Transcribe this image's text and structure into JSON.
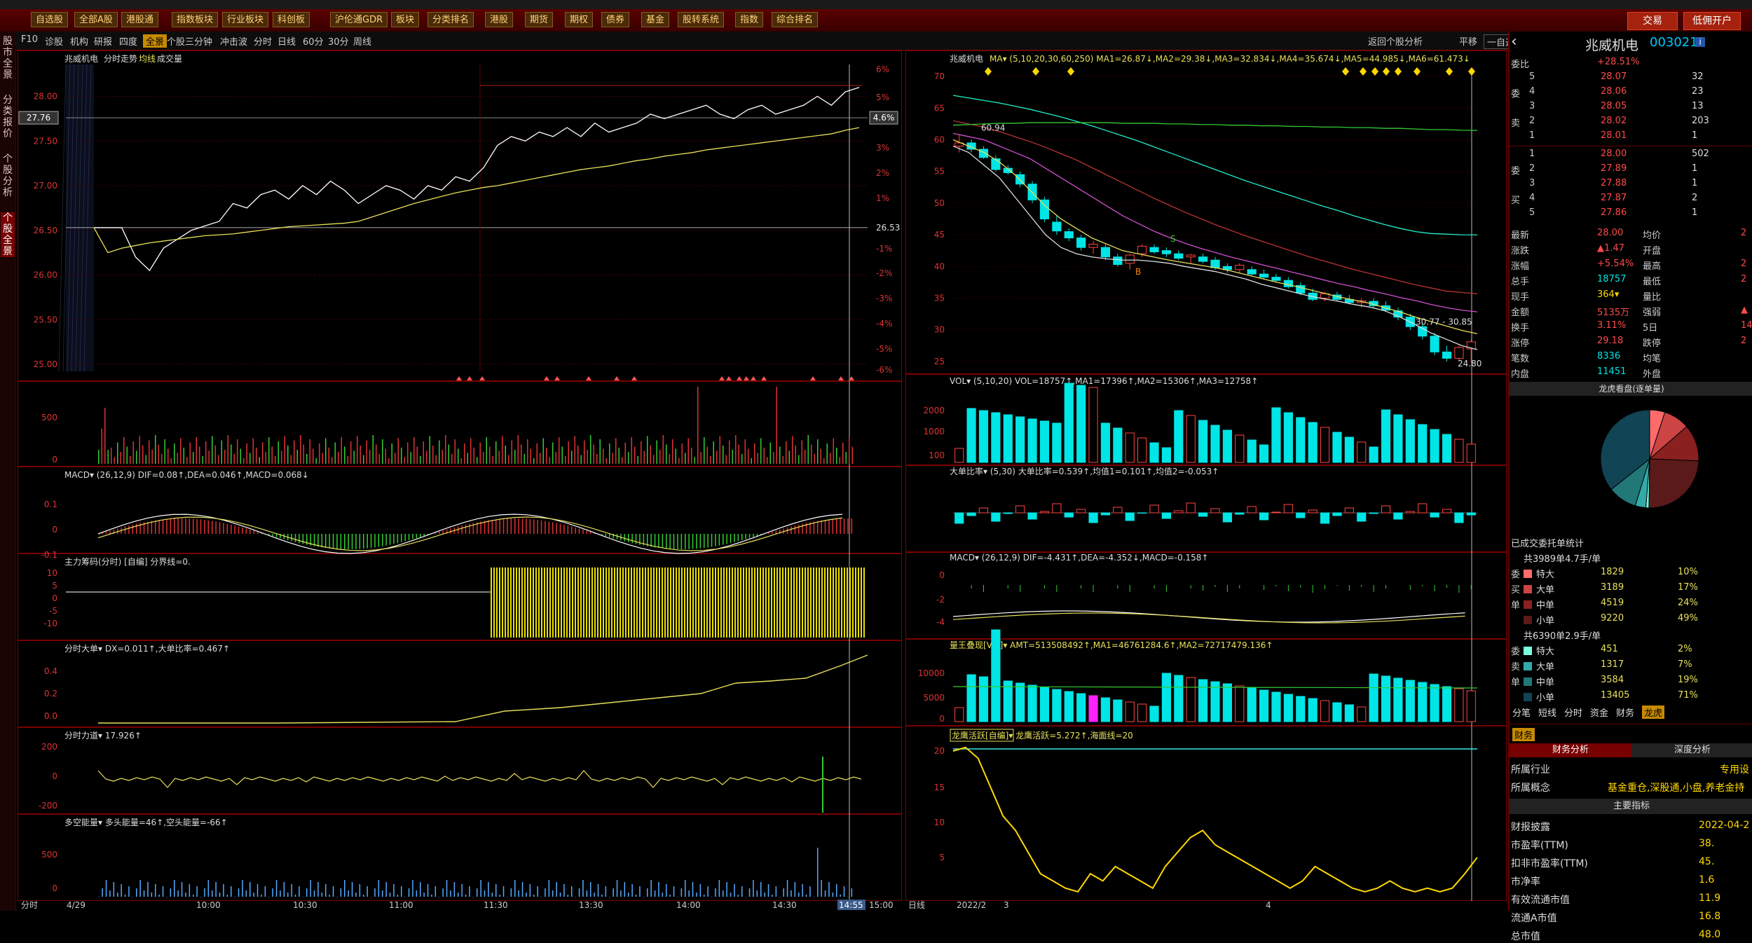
{
  "menu": [
    "自选股",
    "全部A股",
    "港股通",
    "指数板块",
    "行业板块",
    "科创板",
    "沪伦通GDR",
    "板块",
    "分类排名",
    "港股",
    "期货",
    "期权",
    "债券",
    "基金",
    "股转系统",
    "指数",
    "综合排名"
  ],
  "actions": {
    "trade": "交易",
    "open_account": "低佣开户"
  },
  "left_tabs": [
    "股市全景",
    "分类报价",
    "个股分析",
    "个股全景"
  ],
  "toolbar": {
    "items": [
      "F10",
      "诊股",
      "机构",
      "研报",
      "四度",
      "全景",
      "个股三分钟",
      "冲击波",
      "分时",
      "日线",
      "60分",
      "30分",
      "周线"
    ],
    "active": "全景",
    "right_items": [
      "返回个股分析",
      "平移",
      "一自选"
    ]
  },
  "intraday": {
    "title": "兆威机电 分时走势 均线 成交量",
    "price_ticks": [
      "28.00",
      "27.50",
      "27.00",
      "26.50",
      "26.00",
      "25.50",
      "25.00"
    ],
    "pct_ticks": [
      "6%",
      "5%",
      "4.6%",
      "3%",
      "2%",
      "1%",
      "-1%",
      "-2%",
      "-3%",
      "-4%",
      "-5%",
      "-6%"
    ],
    "current_price": "27.76",
    "current_pct": "4.6%",
    "prev_close": "26.53",
    "price_line": [
      26.53,
      26.53,
      26.53,
      26.2,
      26.05,
      26.3,
      26.4,
      26.5,
      26.55,
      26.6,
      26.8,
      26.75,
      26.9,
      26.95,
      26.85,
      27.0,
      26.9,
      27.05,
      26.95,
      26.8,
      26.9,
      27.0,
      26.95,
      26.85,
      27.0,
      26.95,
      27.1,
      27.05,
      27.2,
      27.45,
      27.55,
      27.5,
      27.6,
      27.55,
      27.65,
      27.55,
      27.7,
      27.6,
      27.65,
      27.7,
      27.8,
      27.75,
      27.8,
      27.85,
      27.9,
      27.8,
      27.75,
      27.85,
      27.9,
      27.8,
      27.85,
      27.9,
      28.0,
      27.9,
      28.05,
      28.1
    ],
    "avg_line": [
      26.53,
      26.25,
      26.3,
      26.33,
      26.36,
      26.38,
      26.4,
      26.42,
      26.44,
      26.45,
      26.46,
      26.48,
      26.5,
      26.52,
      26.54,
      26.55,
      26.56,
      26.57,
      26.58,
      26.6,
      26.65,
      26.7,
      26.75,
      26.8,
      26.84,
      26.88,
      26.92,
      26.95,
      26.98,
      27.0,
      27.03,
      27.06,
      27.09,
      27.12,
      27.15,
      27.18,
      27.2,
      27.22,
      27.25,
      27.28,
      27.3,
      27.33,
      27.35,
      27.37,
      27.4,
      27.42,
      27.44,
      27.46,
      27.48,
      27.5,
      27.52,
      27.54,
      27.56,
      27.58,
      27.62,
      27.65
    ],
    "vol_ticks": [
      "500",
      "0"
    ],
    "time_labels": [
      "分时",
      "4/29",
      "10:00",
      "10:30",
      "11:00",
      "11:30",
      "13:30",
      "14:00",
      "14:30",
      "14:55",
      "15:00"
    ]
  },
  "sub": {
    "macd": "MACD▾ (26,12,9) DIF=0.08↑,DEA=0.046↑,MACD=0.068↓",
    "zlcm": "主力筹码(分时) [自编] 分界线=0.",
    "fsdd": "分时大单▾ DX=0.011↑,大单比率=0.467↑",
    "fsld": "分时力道▾ 17.926↑",
    "dkn": "多空能量▾ 多头能量=46↑,空头能量=-66↑",
    "macd_ticks": [
      "0.1",
      "0",
      "-0.1"
    ],
    "zl_ticks": [
      "10",
      "5",
      "0",
      "-5",
      "-10"
    ],
    "dd_ticks": [
      "0.4",
      "0.2",
      "0.0"
    ],
    "ld_ticks": [
      "200",
      "0",
      "-200"
    ],
    "dk_ticks": [
      "500",
      "0"
    ]
  },
  "daily": {
    "title": "兆威机电",
    "ma_label": "MA▾ (5,10,20,30,60,250) MA1=26.87↓,MA2=29.38↓,MA3=32.834↓,MA4=35.674↓,MA5=44.985↓,MA6=61.473↓",
    "price_ticks": [
      "70",
      "65",
      "60",
      "55",
      "50",
      "45",
      "40",
      "35",
      "30",
      "25"
    ],
    "high_mark": "60.94",
    "low_mark": "24.80",
    "range_mark": "30.77 - 30.85",
    "candles": [
      [
        59,
        60.9,
        58,
        59.5
      ],
      [
        59.5,
        60,
        58,
        58.5
      ],
      [
        58.5,
        59,
        57,
        57.2
      ],
      [
        57,
        57.5,
        55,
        55.3
      ],
      [
        55.5,
        56,
        54.5,
        54.8
      ],
      [
        54.5,
        55,
        52.5,
        53
      ],
      [
        53,
        53.5,
        50,
        50.5
      ],
      [
        50.5,
        51,
        47,
        47.5
      ],
      [
        47,
        48,
        45,
        45.6
      ],
      [
        45.5,
        46,
        44,
        44.5
      ],
      [
        44.5,
        45,
        42.5,
        43
      ],
      [
        43,
        44,
        42,
        43.5
      ],
      [
        43,
        43.5,
        41,
        41.5
      ],
      [
        41.5,
        42,
        40,
        40.3
      ],
      [
        40.5,
        42,
        39.5,
        41.8
      ],
      [
        42,
        43.5,
        41.5,
        43.2
      ],
      [
        43,
        43.5,
        42,
        42.3
      ],
      [
        42.5,
        43,
        41.5,
        42
      ],
      [
        42,
        42.5,
        41,
        41.3
      ],
      [
        41.5,
        42,
        40.5,
        41.8
      ],
      [
        41.5,
        42,
        40.5,
        40.8
      ],
      [
        41,
        41.5,
        39.5,
        39.8
      ],
      [
        40,
        40.5,
        39,
        39.5
      ],
      [
        39.5,
        40.5,
        39,
        40.2
      ],
      [
        39.5,
        40,
        38.5,
        38.8
      ],
      [
        38.8,
        39.5,
        38,
        38.3
      ],
      [
        38.3,
        38.8,
        37.5,
        37.8
      ],
      [
        37.8,
        38.3,
        36.5,
        36.8
      ],
      [
        37,
        37.5,
        35.5,
        35.8
      ],
      [
        35.8,
        36.5,
        34.5,
        34.8
      ],
      [
        35,
        36,
        34.5,
        35.7
      ],
      [
        35.5,
        36,
        34.5,
        34.8
      ],
      [
        34.8,
        35.5,
        34,
        34.3
      ],
      [
        34.3,
        35,
        33.5,
        34.6
      ],
      [
        34.5,
        35,
        33.5,
        33.8
      ],
      [
        33.8,
        34.5,
        32.8,
        33.1
      ],
      [
        33,
        33.5,
        31.5,
        32
      ],
      [
        32,
        32.5,
        30,
        30.5
      ],
      [
        30.5,
        31,
        28.5,
        29
      ],
      [
        29,
        29.5,
        26,
        26.5
      ],
      [
        26.5,
        27.5,
        25,
        25.5
      ],
      [
        25.5,
        27.5,
        25.2,
        27.2
      ],
      [
        27,
        28.5,
        24.8,
        28.1
      ]
    ],
    "ma_lines": {
      "ma5": [
        59,
        58,
        56,
        54,
        51,
        48,
        45,
        43,
        42,
        41.5,
        41.2,
        41,
        41,
        40.8,
        40.5,
        40,
        39.6,
        39.2,
        38.6,
        38,
        37.2,
        36.6,
        36,
        35.4,
        34.9,
        34.5,
        34,
        33.6,
        33,
        32,
        30.8,
        29.5,
        28.5,
        27.5,
        26.87
      ],
      "ma10": [
        60,
        59,
        58,
        56.5,
        54.5,
        52,
        49.5,
        47.5,
        46,
        44.5,
        43.5,
        42.5,
        42,
        41.5,
        41,
        40.6,
        40.2,
        39.8,
        39.3,
        38.7,
        38.1,
        37.5,
        37,
        36.4,
        35.8,
        35.2,
        34.7,
        34.2,
        33.5,
        32.8,
        32,
        31.3,
        30.6,
        29.9,
        29.38
      ],
      "ma20": [
        61,
        60.5,
        60,
        59,
        58,
        57,
        55.5,
        54,
        52.5,
        51,
        49.5,
        48,
        46.8,
        45.6,
        44.6,
        43.7,
        42.9,
        42.2,
        41.5,
        40.9,
        40.3,
        39.7,
        39.1,
        38.5,
        37.9,
        37.3,
        36.8,
        36.2,
        35.7,
        35.1,
        34.6,
        34,
        33.5,
        33.1,
        32.834
      ],
      "ma30": [
        63,
        62.5,
        62,
        61.3,
        60.5,
        59.7,
        58.8,
        57.8,
        56.8,
        55.6,
        54.4,
        53.2,
        52,
        50.8,
        49.7,
        48.6,
        47.6,
        46.6,
        45.7,
        44.8,
        44,
        43.2,
        42.4,
        41.6,
        40.9,
        40.2,
        39.5,
        38.9,
        38.3,
        37.7,
        37.1,
        36.6,
        36.1,
        35.9,
        35.674
      ],
      "ma60": [
        67,
        66.6,
        66.2,
        65.8,
        65.3,
        64.8,
        64.2,
        63.6,
        62.9,
        62.2,
        61.4,
        60.6,
        59.8,
        58.9,
        58,
        57.1,
        56.2,
        55.3,
        54.4,
        53.5,
        52.7,
        51.9,
        51.1,
        50.3,
        49.5,
        48.8,
        48,
        47.3,
        46.6,
        46,
        45.5,
        45.2,
        45.1,
        45,
        44.985
      ],
      "ma250": [
        62.3,
        62.4,
        62.5,
        62.6,
        62.6,
        62.7,
        62.7,
        62.7,
        62.7,
        62.7,
        62.7,
        62.6,
        62.6,
        62.6,
        62.5,
        62.5,
        62.4,
        62.4,
        62.3,
        62.3,
        62.2,
        62.2,
        62.1,
        62.1,
        62,
        62,
        61.9,
        61.9,
        61.8,
        61.8,
        61.7,
        61.6,
        61.6,
        61.5,
        61.473
      ]
    },
    "vol_label": "VOL▾ (5,10,20) VOL=18757↑,MA1=17396↑,MA2=15306↑,MA3=12758↑",
    "vol_ticks": [
      "2000",
      "1000",
      "100"
    ],
    "ddbl_label": "大单比率▾ (5,30) 大单比率=0.539↑,均值1=0.101↑,均值2=-0.053↑",
    "macd_label": "MACD▾ (26,12,9) DIF=-4.431↑,DEA=-4.352↓,MACD=-0.158↑",
    "macd_ticks": [
      "0",
      "-2",
      "-4"
    ],
    "lwdx_label": "量王叠现[VIP]▾ AMT=513508492↑,MA1=46761284.6↑,MA2=72717479.136↑",
    "lw_ticks": [
      "10000",
      "5000",
      "0"
    ],
    "lyhy_label": "龙鹰活跃[自编]▾ 龙鹰活跃=5.272↑,海面线=20",
    "ly_ticks": [
      "20",
      "15",
      "10",
      "5"
    ],
    "ly_line": [
      20,
      20.5,
      19,
      15,
      11,
      9,
      6,
      3,
      2,
      1,
      0.5,
      3,
      2,
      4,
      3,
      2,
      1,
      4,
      6,
      8,
      9,
      7,
      6,
      5,
      4,
      3,
      2,
      1,
      2,
      4,
      3,
      2,
      1,
      0.5,
      1,
      2,
      1,
      0.5,
      1,
      0.5,
      1,
      3,
      5.272
    ],
    "time_labels": [
      "日线",
      "2022/2",
      "3",
      "4"
    ]
  },
  "quote": {
    "name": "兆威机电",
    "code": "003021",
    "wei_bi_label": "委比",
    "wei_bi": "+28.51%",
    "sell": [
      [
        "5",
        "28.07",
        "32"
      ],
      [
        "4",
        "28.06",
        "23"
      ],
      [
        "3",
        "28.05",
        "13"
      ],
      [
        "2",
        "28.02",
        "203"
      ],
      [
        "1",
        "28.01",
        "1"
      ]
    ],
    "buy": [
      [
        "1",
        "28.00",
        "502"
      ],
      [
        "2",
        "27.89",
        "1"
      ],
      [
        "3",
        "27.88",
        "1"
      ],
      [
        "4",
        "27.87",
        "2"
      ],
      [
        "5",
        "27.86",
        "1"
      ]
    ],
    "sell_side": [
      "委",
      "卖",
      "单"
    ],
    "buy_side": [
      "委",
      "买",
      "单"
    ],
    "stats": [
      [
        "最新",
        "28.00",
        "均价",
        "2"
      ],
      [
        "涨跌",
        "▲1.47",
        "开盘",
        ""
      ],
      [
        "涨幅",
        "+5.54%",
        "最高",
        "2"
      ],
      [
        "总手",
        "18757",
        "最低",
        "2"
      ],
      [
        "现手",
        "364▾",
        "量比",
        ""
      ],
      [
        "金额",
        "5135万",
        "强弱",
        "▲"
      ],
      [
        "换手",
        "3.11%",
        "5日",
        "14."
      ],
      [
        "涨停",
        "29.18",
        "跌停",
        "2"
      ],
      [
        "笔数",
        "8336",
        "均笔",
        ""
      ],
      [
        "内盘",
        "11451",
        "外盘",
        ""
      ]
    ],
    "pie_title": "龙虎看盘(逐单量)",
    "pie_slices": [
      {
        "value": 10,
        "color": "#ff6b6b"
      },
      {
        "value": 17,
        "color": "#c44"
      },
      {
        "value": 24,
        "color": "#8a2020"
      },
      {
        "value": 49,
        "color": "#5a1a1a"
      },
      {
        "value": 2,
        "color": "#7fd"
      },
      {
        "value": 7,
        "color": "#3aa"
      },
      {
        "value": 19,
        "color": "#277"
      },
      {
        "value": 71,
        "color": "#145"
      }
    ],
    "entrust_title": "已成交委托单统计",
    "buy_total": "共3989单4.7手/单",
    "buy_rows": [
      [
        "特大",
        "1829",
        "10%"
      ],
      [
        "大单",
        "3189",
        "17%"
      ],
      [
        "中单",
        "4519",
        "24%"
      ],
      [
        "小单",
        "9220",
        "49%"
      ]
    ],
    "sell_total": "共6390单2.9手/单",
    "sell_rows": [
      [
        "特大",
        "451",
        "2%"
      ],
      [
        "大单",
        "1317",
        "7%"
      ],
      [
        "中单",
        "3584",
        "19%"
      ],
      [
        "小单",
        "13405",
        "71%"
      ]
    ],
    "tabs": [
      "分笔",
      "短线",
      "分时",
      "资金",
      "财务",
      "龙虎"
    ],
    "fin_tab": "财务",
    "fin_sub": [
      "财务分析",
      "深度分析"
    ],
    "industry_label": "所属行业",
    "industry": "专用设",
    "concept_label": "所属概念",
    "concept": "基金重仓,深股通,小盘,养老金持",
    "key_metrics": "主要指标",
    "metrics": [
      [
        "财报披露",
        "2022-04-2"
      ],
      [
        "市盈率(TTM)",
        "38."
      ],
      [
        "扣非市盈率(TTM)",
        "45."
      ],
      [
        "市净率",
        "1.6"
      ],
      [
        "有效流通市值",
        "11.9"
      ],
      [
        "流通A市值",
        "16.8"
      ],
      [
        "总市值",
        "48.0"
      ]
    ]
  }
}
